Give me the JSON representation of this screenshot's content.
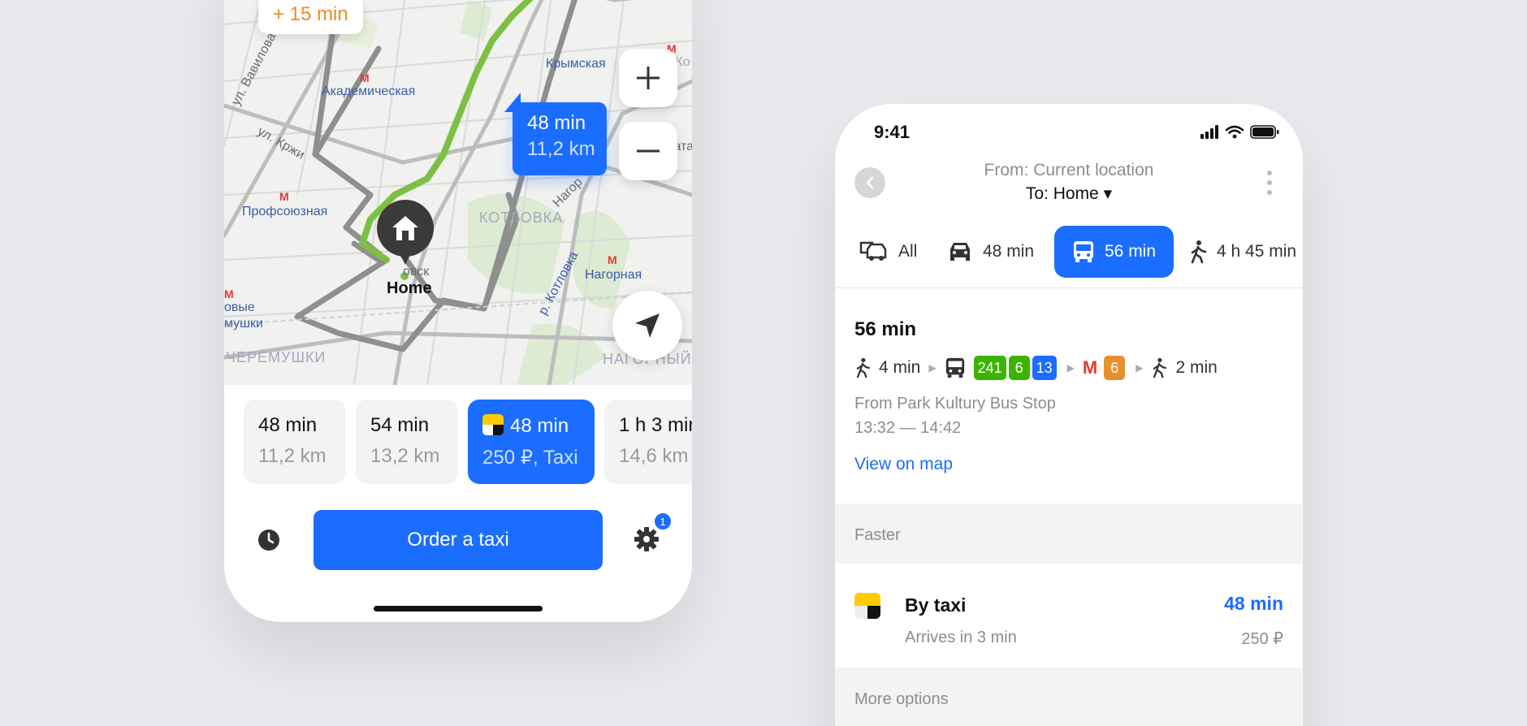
{
  "left_phone": {
    "map": {
      "eta_chip": "+ 15 min",
      "route_bubble": {
        "time": "48 min",
        "distance": "11,2 km"
      },
      "home_label": "Home",
      "labels": {
        "akademicheskaya": "Академическая",
        "krymskaya": "Крымская",
        "verkhnie_ko": "Верхние Ко",
        "profsoyuznaya": "Профсоюзная",
        "kotlovka": "КОТЛОВКА",
        "nagornaya": "Нагорная",
        "nagor_rot": "Нагор",
        "r_kotlovka": "р. Котловка",
        "ul_vavilova": "ул. Вавилова",
        "ul_krzhizh": "ул. Кржи",
        "novye_cheryomushki_1": "овые",
        "novye_cheryomushki_2": "мушки",
        "cheryomushki": "ЧЕРЁМУШКИ",
        "nagorny": "НАГОРНЫЙ",
        "gata": "гата",
        "ovsk": "овск"
      }
    },
    "route_options": [
      {
        "time": "48 min",
        "detail": "11,2 km"
      },
      {
        "time": "54 min",
        "detail": "13,2 km"
      },
      {
        "time": "48 min",
        "detail": "250 ₽, Taxi"
      },
      {
        "time": "1 h 3 min",
        "detail": "14,6 km"
      }
    ],
    "order_button": "Order a taxi",
    "settings_badge": "1"
  },
  "right_phone": {
    "status_time": "9:41",
    "from": "From: Current location",
    "to": "To: Home ▾",
    "tabs": [
      {
        "label": "All",
        "icon": "multi-transport-icon"
      },
      {
        "label": "48 min",
        "icon": "car-icon"
      },
      {
        "label": "56 min",
        "icon": "bus-icon"
      },
      {
        "label": "4 h 45 min",
        "icon": "walk-icon"
      }
    ],
    "route": {
      "total": "56 min",
      "walk_start": "4 min",
      "bus_lines": [
        "241",
        "6",
        "13"
      ],
      "metro_line": "6",
      "walk_end": "2 min",
      "from_stop": "From Park Kultury Bus Stop",
      "time_range": "13:32 — 14:42",
      "view_map": "View on map"
    },
    "faster_header": "Faster",
    "taxi": {
      "title": "By taxi",
      "subtitle": "Arrives in 3 min",
      "time": "48 min",
      "price": "250 ₽"
    },
    "more_header": "More options"
  },
  "colors": {
    "accent": "#1a6dff",
    "route_green": "#7bc043",
    "eta_orange": "#f08a24",
    "metro_red": "#e53935",
    "badge_green": "#3cb300",
    "badge_blue": "#1a6dff",
    "badge_orange": "#e8902e"
  }
}
